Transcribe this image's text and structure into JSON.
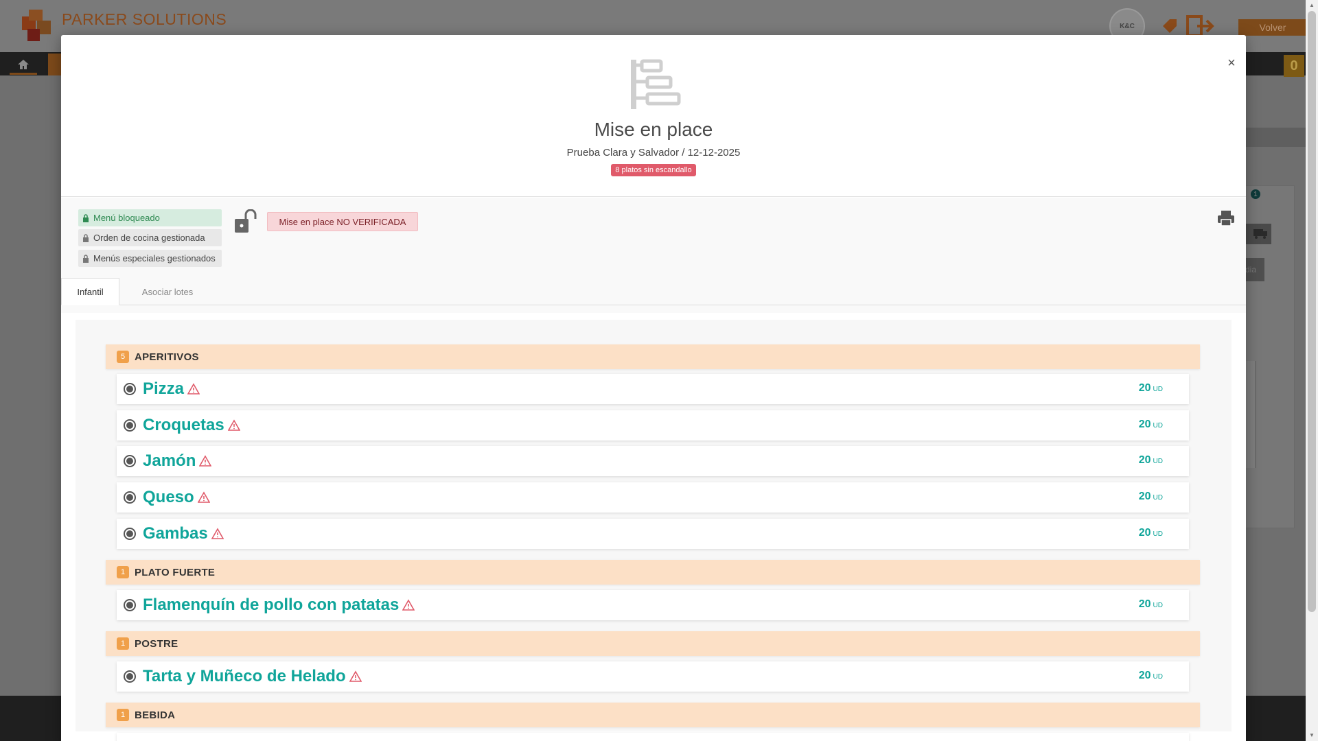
{
  "background": {
    "logo_text": "PARKER SOLUTIONS",
    "avatar_text": "K&C",
    "volver_label": "Volver",
    "counter": "0",
    "badge": "1",
    "side_button_text": "dia"
  },
  "modal": {
    "icon": "mise-en-place-hierarchy-icon",
    "title": "Mise en place",
    "subtitle": "Prueba Clara y Salvador / 12-12-2025",
    "warning_badge": "8 platos sin escandallo",
    "close_label": "×"
  },
  "status": {
    "menu_locked": "Menú bloqueado",
    "kitchen_order": "Orden de cocina gestionada",
    "special_menus": "Menús especiales gestionados",
    "verification": "Mise en place NO VERIFICADA"
  },
  "tabs": [
    "Infantil",
    "Asociar lotes"
  ],
  "categories": [
    {
      "name": "APERITIVOS",
      "count": "5",
      "dishes": [
        {
          "name": "Pizza",
          "qty": "20",
          "unit": "UD"
        },
        {
          "name": "Croquetas",
          "qty": "20",
          "unit": "UD"
        },
        {
          "name": "Jamón",
          "qty": "20",
          "unit": "UD"
        },
        {
          "name": "Queso",
          "qty": "20",
          "unit": "UD"
        },
        {
          "name": "Gambas",
          "qty": "20",
          "unit": "UD"
        }
      ]
    },
    {
      "name": "PLATO FUERTE",
      "count": "1",
      "dishes": [
        {
          "name": "Flamenquín de pollo con patatas",
          "qty": "20",
          "unit": "UD"
        }
      ]
    },
    {
      "name": "POSTRE",
      "count": "1",
      "dishes": [
        {
          "name": "Tarta y Muñeco de Helado",
          "qty": "20",
          "unit": "UD"
        }
      ]
    },
    {
      "name": "BEBIDA",
      "count": "1",
      "dishes": []
    }
  ],
  "colors": {
    "accent_teal": "#10a59a",
    "category_bg": "#fce0c6",
    "count_badge": "#f0a04a",
    "warning_red": "#e05a6a",
    "locked_green": "#2f8a52"
  }
}
